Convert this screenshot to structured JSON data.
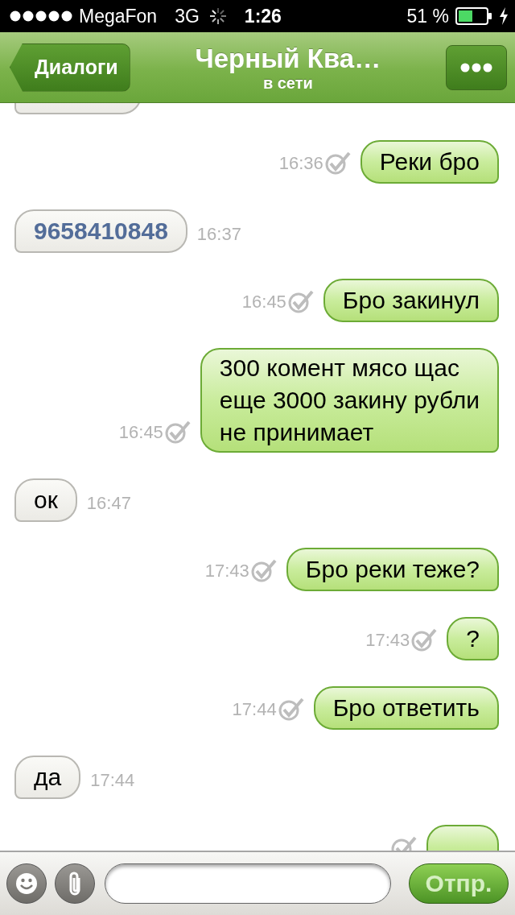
{
  "status_bar": {
    "carrier": "MegaFon",
    "network": "3G",
    "time": "1:26",
    "battery": "51 %"
  },
  "nav_bar": {
    "back": "Диалоги",
    "title": "Черный Ква…",
    "subtitle": "в сети"
  },
  "messages": [
    {
      "kind": "sent",
      "text": "Реки бро",
      "time": "16:36",
      "read": true
    },
    {
      "kind": "received_number",
      "text": "9658410848",
      "time": "16:37"
    },
    {
      "kind": "sent",
      "text": "Бро закинул",
      "time": "16:45",
      "read": true
    },
    {
      "kind": "sent",
      "text": "300 комент мясо щас\nеще 3000 закину рубли\nне принимает",
      "time": "16:45",
      "read": true
    },
    {
      "kind": "received",
      "text": "ок",
      "time": "16:47"
    },
    {
      "kind": "sent",
      "text": "Бро реки теже?",
      "time": "17:43",
      "read": true
    },
    {
      "kind": "sent",
      "text": "?",
      "time": "17:43",
      "read": true
    },
    {
      "kind": "sent",
      "text": "Бро ответить",
      "time": "17:44",
      "read": true
    },
    {
      "kind": "received",
      "text": "да",
      "time": "17:44"
    },
    {
      "kind": "sent",
      "read": true
    }
  ],
  "composer": {
    "send": "Отпр."
  }
}
